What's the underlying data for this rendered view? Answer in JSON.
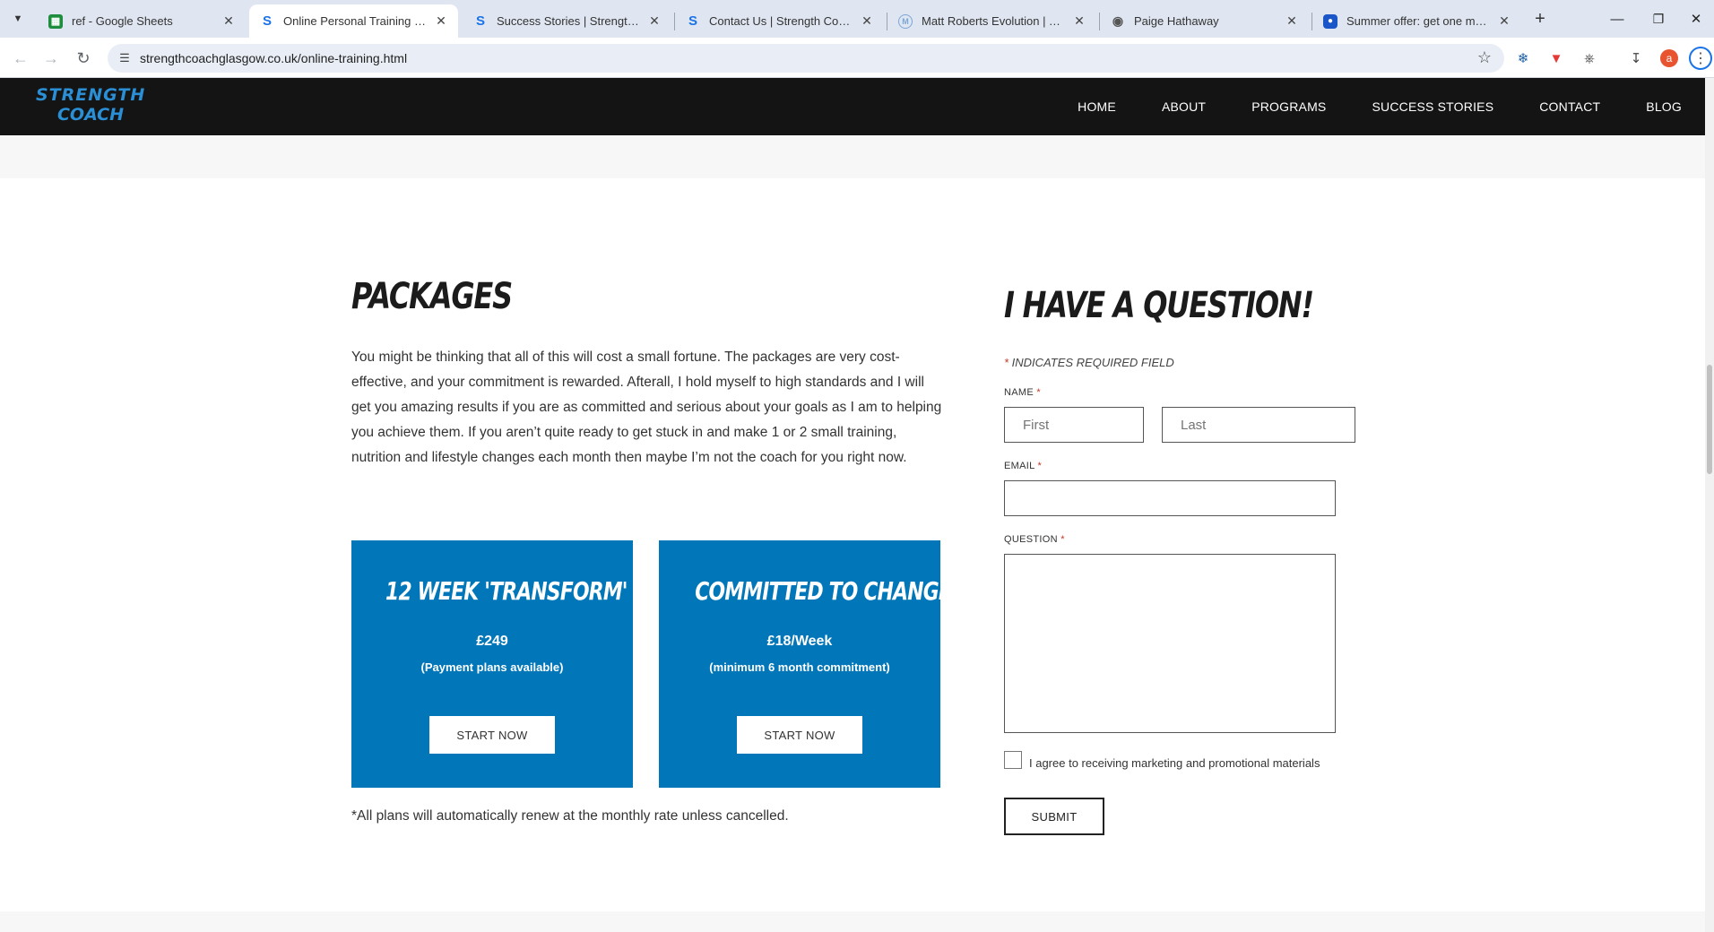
{
  "browser": {
    "tabs": [
      {
        "title": "ref - Google Sheets",
        "icon": "sheets-icon",
        "color": "#1e8e3e"
      },
      {
        "title": "Online Personal Training | Stren",
        "icon": "strength-coach-icon",
        "color": "#1a73e8",
        "active": true
      },
      {
        "title": "Success Stories | Strength Coac",
        "icon": "strength-coach-icon",
        "color": "#1a73e8"
      },
      {
        "title": "Contact Us | Strength Coach Gl",
        "icon": "strength-coach-icon",
        "color": "#1a73e8"
      },
      {
        "title": "Matt Roberts Evolution | Young",
        "icon": "matt-roberts-icon",
        "color": "#7aa6d8"
      },
      {
        "title": "Paige Hathaway",
        "icon": "globe-icon",
        "color": "#555555"
      },
      {
        "title": "Summer offer: get one month f",
        "icon": "offer-icon",
        "color": "#1a56c7"
      }
    ],
    "url": "strengthcoachglasgow.co.uk/online-training.html",
    "profile_initial": "a"
  },
  "site": {
    "logo_line1": "STRENGTH",
    "logo_line2": "COACH",
    "nav": [
      "HOME",
      "ABOUT",
      "PROGRAMS",
      "SUCCESS STORIES",
      "CONTACT",
      "BLOG"
    ]
  },
  "packages": {
    "title": "PACKAGES",
    "intro": "You might be thinking that all of this will cost a small fortune. The packages are very cost-effective, and your commitment is rewarded. Afterall, I hold myself to high standards and I will get you amazing results if you are as committed and serious about your goals as I am to helping you achieve them. If you aren’t quite ready to get stuck in and make 1 or 2 small training, nutrition and lifestyle changes each month then maybe I’m not the coach for you right now.",
    "cards": [
      {
        "title": "12 WEEK 'TRANSFORM'",
        "price": "£249",
        "note": "(Payment plans available)",
        "button": "START NOW"
      },
      {
        "title": "COMMITTED TO CHANGE",
        "price": "£18/Week",
        "note": "(minimum 6 month commitment)",
        "button": "START NOW"
      }
    ],
    "footnote": "*All plans will automatically renew at the monthly rate unless cancelled."
  },
  "form": {
    "title": "I HAVE A QUESTION!",
    "required_note": "INDICATES REQUIRED FIELD",
    "name_label": "NAME",
    "first_placeholder": "First",
    "last_placeholder": "Last",
    "email_label": "EMAIL",
    "question_label": "QUESTION",
    "consent": "I agree to receiving marketing and promotional materials",
    "submit": "SUBMIT"
  }
}
